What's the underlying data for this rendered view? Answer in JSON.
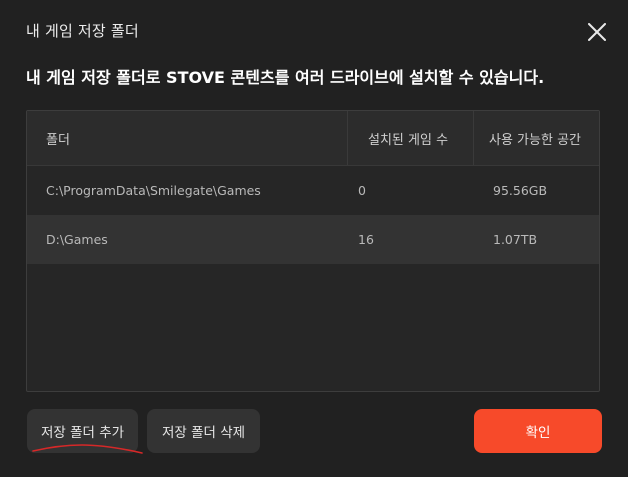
{
  "dialog": {
    "title": "내 게임 저장 폴더",
    "description": "내 게임 저장 폴더로 STOVE 콘텐츠를 여러 드라이브에 설치할 수 있습니다."
  },
  "table": {
    "headers": {
      "folder": "폴더",
      "installed_games": "설치된 게임 수",
      "available_space": "사용 가능한 공간"
    },
    "rows": [
      {
        "folder": "C:\\ProgramData\\Smilegate\\Games",
        "installed_games": "0",
        "available_space": "95.56GB"
      },
      {
        "folder": "D:\\Games",
        "installed_games": "16",
        "available_space": "1.07TB"
      }
    ]
  },
  "buttons": {
    "add_folder": "저장 폴더 추가",
    "delete_folder": "저장 폴더 삭제",
    "confirm": "확인"
  },
  "icons": {
    "close": "close-icon"
  },
  "colors": {
    "background": "#212121",
    "confirm": "#f74a2a",
    "secondary_button": "#333333",
    "annotation": "#d62828"
  }
}
